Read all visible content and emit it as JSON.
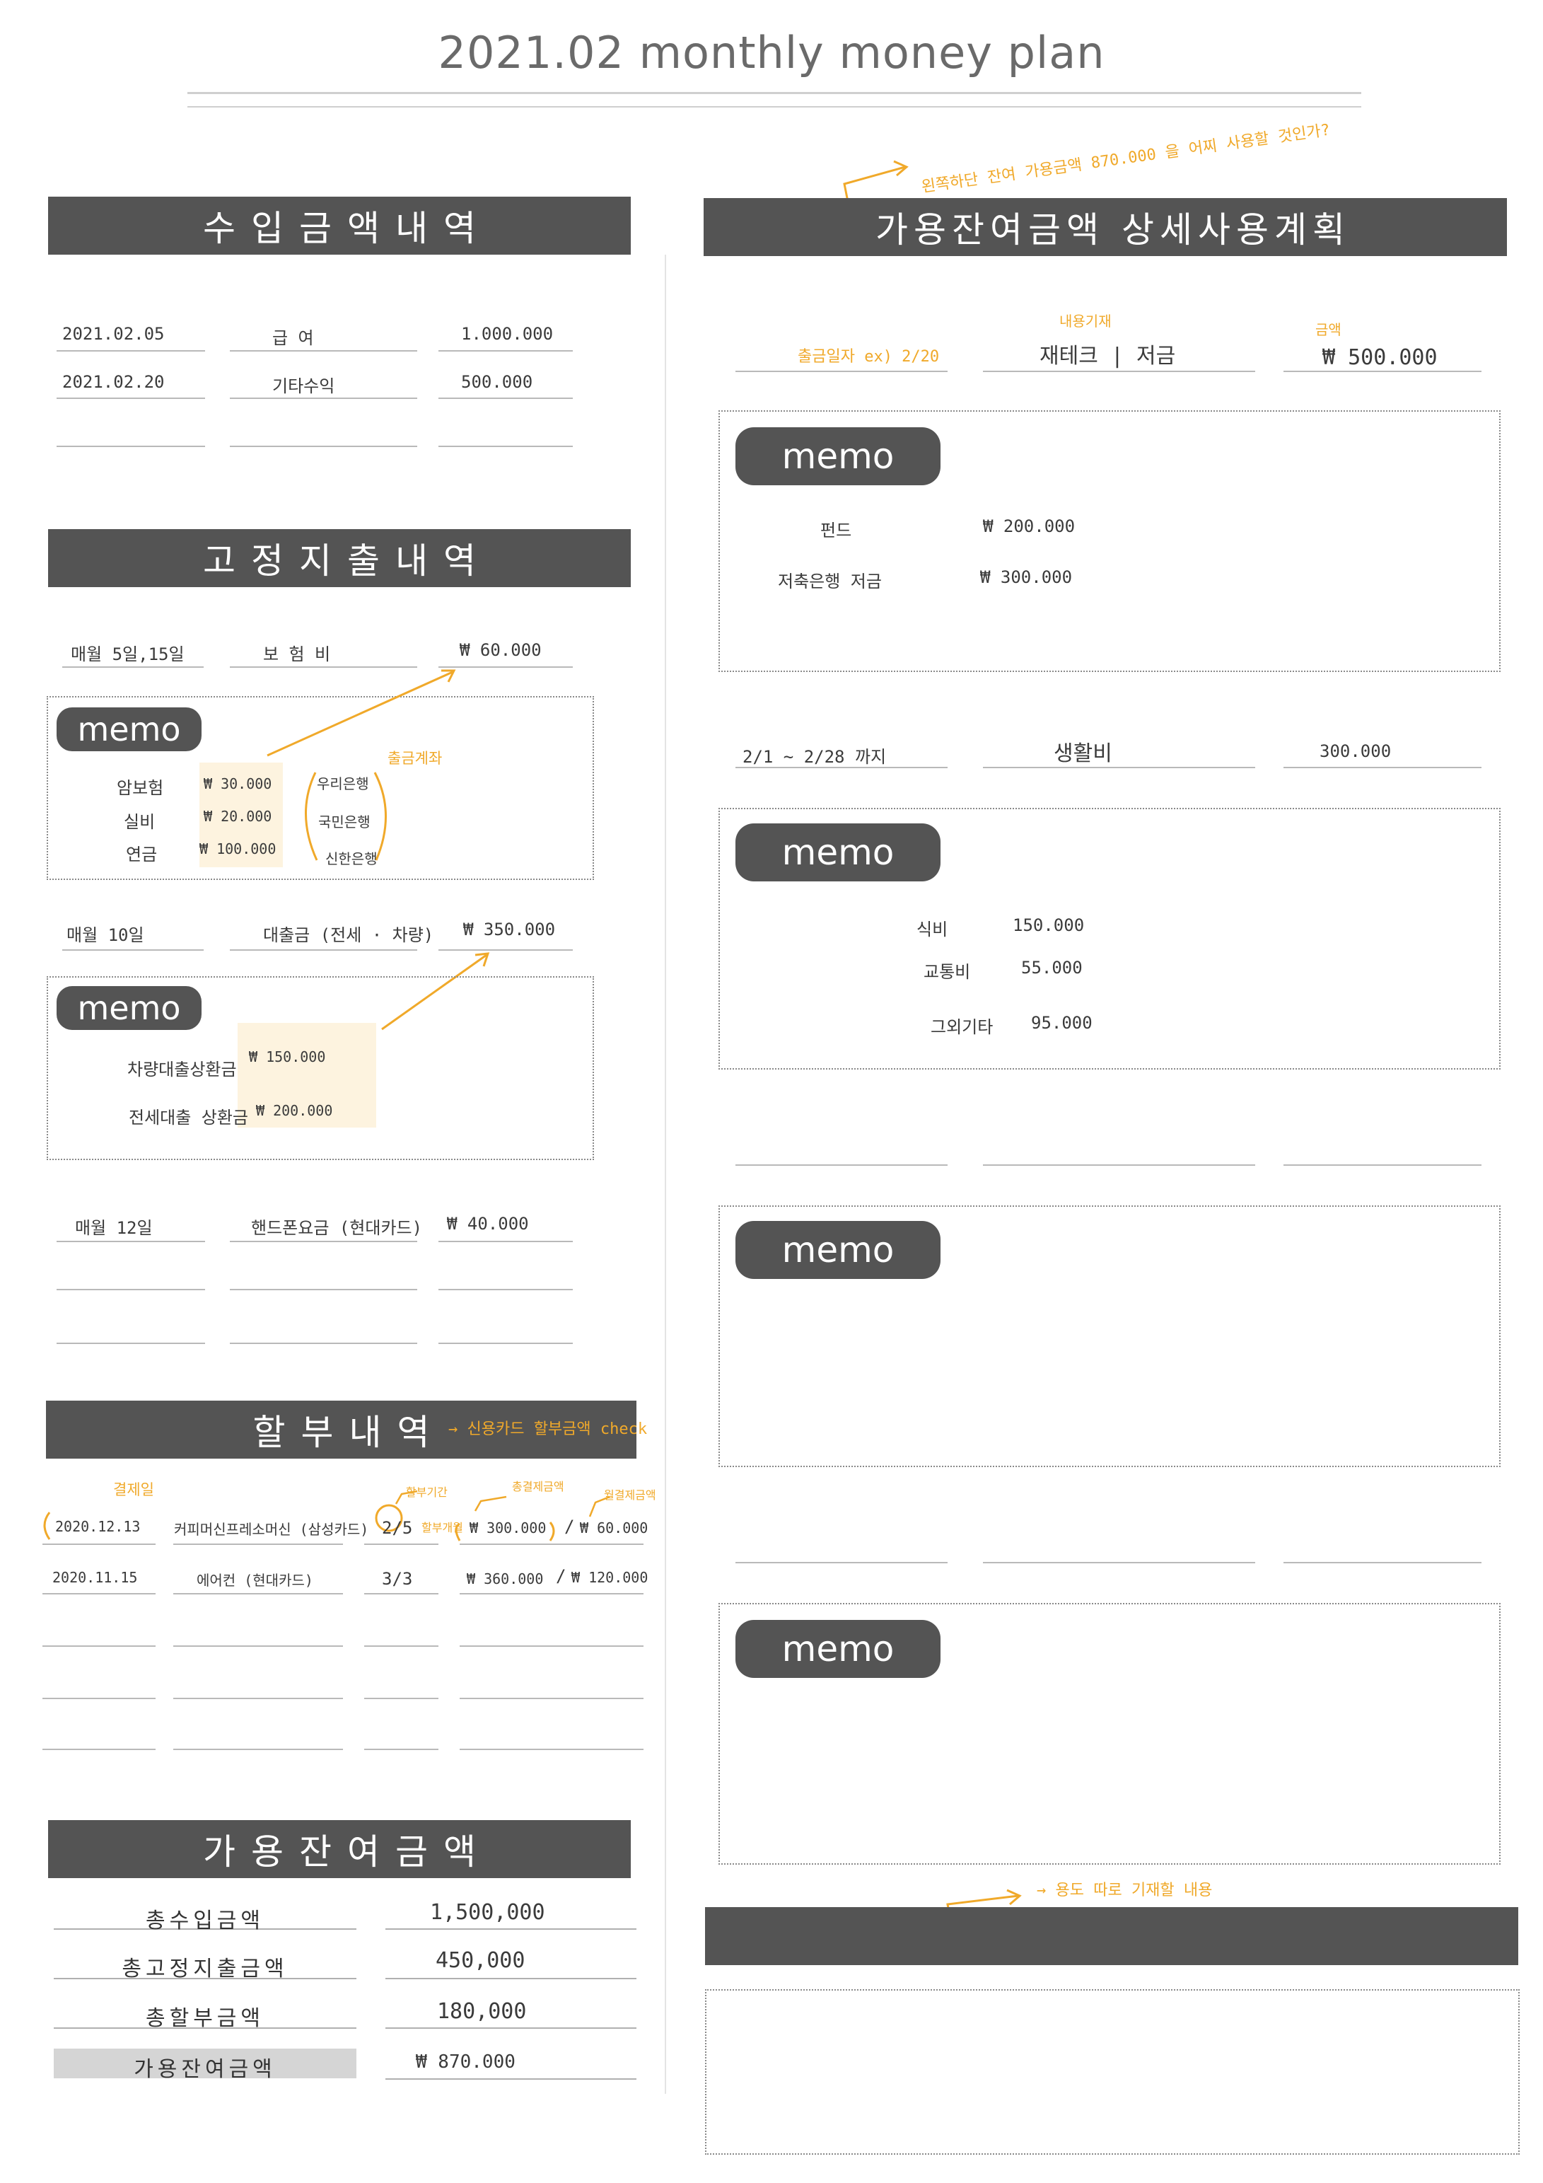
{
  "title": "2021.02 monthly money plan",
  "sections": {
    "income": "수입금액내역",
    "fixed": "고정지출내역",
    "installment": "할부내역",
    "available": "가용잔여금액",
    "detail": "가용잔여금액 상세사용계획"
  },
  "income_rows": [
    {
      "date": "2021.02.05",
      "item": "급 여",
      "amount": "1.000.000"
    },
    {
      "date": "2021.02.20",
      "item": "기타수익",
      "amount": "500.000"
    }
  ],
  "fixed_rows": [
    {
      "date": "매월 5일,15일",
      "item": "보 험 비",
      "amount": "₩ 60.000"
    },
    {
      "date": "매월 10일",
      "item": "대출금 (전세 · 차량)",
      "amount": "₩ 350.000"
    },
    {
      "date": "매월 12일",
      "item": "핸드폰요금 (현대카드)",
      "amount": "₩ 40.000"
    }
  ],
  "memo_label": "memo",
  "fixed_memo1": {
    "items": [
      {
        "name": "암보험",
        "amount": "₩ 30.000"
      },
      {
        "name": "실비",
        "amount": "₩ 20.000"
      },
      {
        "name": "연금",
        "amount": "₩ 100.000"
      }
    ],
    "banks": [
      "우리은행",
      "국민은행",
      "신한은행"
    ],
    "note": "출금계좌"
  },
  "fixed_memo2": {
    "items": [
      {
        "name": "차량대출상환금",
        "amount": "₩ 150.000"
      },
      {
        "name": "전세대출 상환금",
        "amount": "₩ 200.000"
      }
    ]
  },
  "installment_note": "→ 신용카드 할부금액 check",
  "installment_annotations": {
    "date": "결제일",
    "months": "할부개월",
    "total": "총결제금액",
    "monthly": "월결제금액",
    "circled": "할부기간"
  },
  "installment_rows": [
    {
      "date": "2020.12.13",
      "item": "커피머신프레소머신 (삼성카드)",
      "months": "2/5",
      "amount": "₩ 300.000",
      "monthly": "₩ 60.000"
    },
    {
      "date": "2020.11.15",
      "item": "에어컨 (현대카드)",
      "months": "3/3",
      "amount": "₩ 360.000",
      "monthly": "₩ 120.000"
    }
  ],
  "summary": [
    {
      "label": "총수입금액",
      "value": "1,500,000"
    },
    {
      "label": "총고정지출금액",
      "value": "450,000"
    },
    {
      "label": "총할부금액",
      "value": "180,000"
    },
    {
      "label": "가용잔여금액",
      "value": "₩ 870.000"
    }
  ],
  "detail_annotation": "왼쪽하단 잔여 가용금액 870.000 을 어찌 사용할 것인가?",
  "detail_heads": {
    "date": "출금일자",
    "content": "내용기재",
    "amount": "금액"
  },
  "detail_rows": [
    {
      "date": "출금일자 ex) 2/20",
      "content": "재테크 | 저금",
      "amount": "₩ 500.000"
    },
    {
      "date": "2/1 ~ 2/28 까지",
      "content": "생활비",
      "amount": "300.000"
    }
  ],
  "detail_memo1": [
    {
      "name": "펀드",
      "amount": "₩ 200.000"
    },
    {
      "name": "저축은행 저금",
      "amount": "₩ 300.000"
    }
  ],
  "detail_memo2": [
    {
      "name": "식비",
      "amount": "150.000"
    },
    {
      "name": "교통비",
      "amount": "55.000"
    },
    {
      "name": "그외기타",
      "amount": "95.000"
    }
  ],
  "bottom_annotation": "→ 용도 따로 기재할 내용",
  "colors": {
    "bar": "#545454",
    "accent": "#f0a92a",
    "highlight": "#fdf3df"
  }
}
